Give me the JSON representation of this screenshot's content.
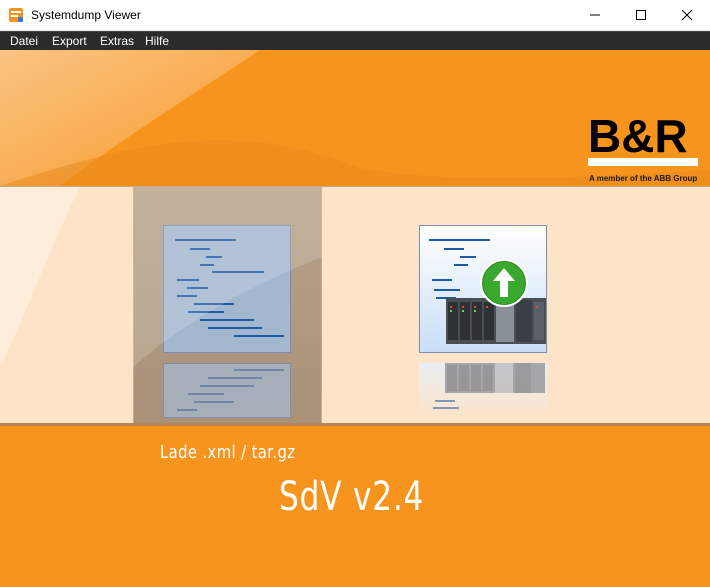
{
  "window": {
    "title": "Systemdump Viewer",
    "icon": "app-icon"
  },
  "menu": {
    "items": [
      "Datei",
      "Export",
      "Extras",
      "Hilfe"
    ]
  },
  "header": {
    "logo_text": "B&R",
    "logo_tagline": "A member of the ABB Group",
    "brand_color": "#f7941d"
  },
  "tiles": [
    {
      "name": "load-file",
      "icon": "document-list-icon",
      "selected": true
    },
    {
      "name": "load-from-target",
      "icon": "plc-upload-icon",
      "selected": false
    }
  ],
  "footer": {
    "action_label": "Lade .xml / tar.gz",
    "version": "SdV v2.4"
  },
  "colors": {
    "orange": "#f7941d",
    "band": "#fde4c8",
    "menubar": "#2b2b2b"
  }
}
